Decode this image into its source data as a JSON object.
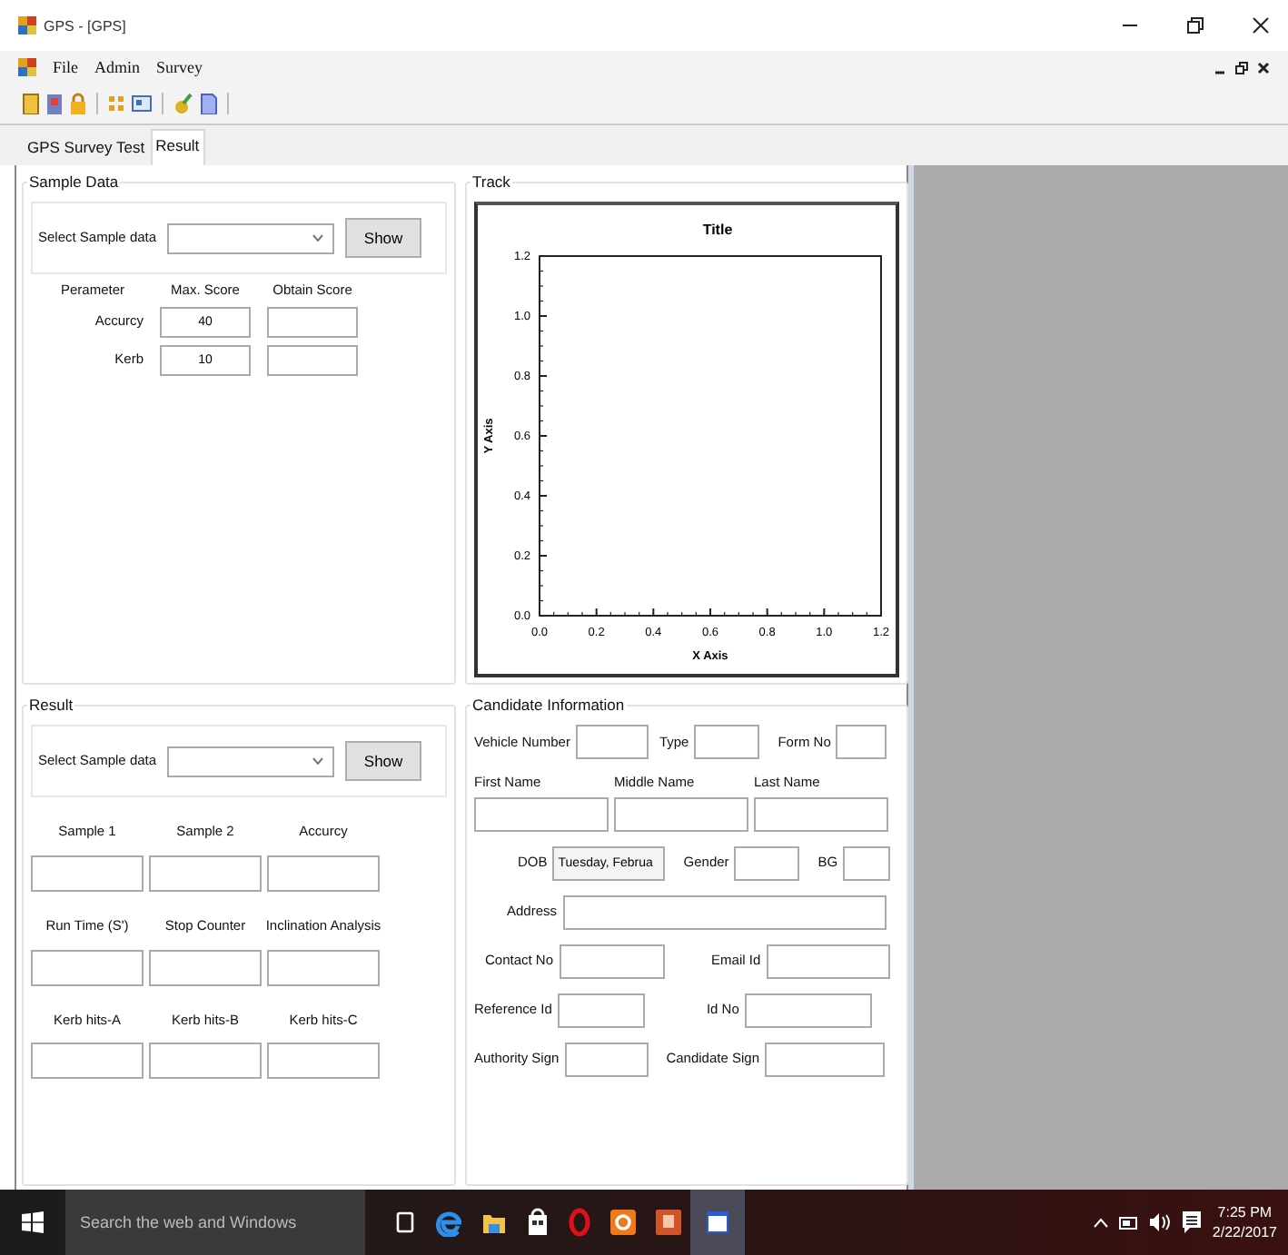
{
  "window": {
    "title": "GPS - [GPS]"
  },
  "menu": [
    "File",
    "Admin",
    "Survey"
  ],
  "tabs": [
    {
      "label": "GPS Survey Test",
      "selected": false
    },
    {
      "label": "Result",
      "selected": true
    }
  ],
  "sample_data": {
    "title": "Sample Data",
    "select_label": "Select Sample data",
    "show_button": "Show",
    "headers": [
      "Perameter",
      "Max. Score",
      "Obtain Score"
    ],
    "rows": [
      {
        "parameter": "Accurcy",
        "max_score": "40"
      },
      {
        "parameter": "Kerb",
        "max_score": "10"
      }
    ]
  },
  "track": {
    "title": "Track",
    "chart_data": {
      "type": "line",
      "title": "Title",
      "xlabel": "X Axis",
      "ylabel": "Y Axis",
      "xlim": [
        0,
        1.2
      ],
      "ylim": [
        0,
        1.2
      ],
      "xticks": [
        {
          "value": 0,
          "label": "0.0"
        },
        {
          "value": 0.2,
          "label": "0.2"
        },
        {
          "value": 0.4,
          "label": "0.4"
        },
        {
          "value": 0.6,
          "label": "0.6"
        },
        {
          "value": 0.8,
          "label": "0.8"
        },
        {
          "value": 1,
          "label": "1.0"
        },
        {
          "value": 1.2,
          "label": "1.2"
        }
      ],
      "yticks": [
        {
          "value": 0,
          "label": "0.0"
        },
        {
          "value": 0.2,
          "label": "0.2"
        },
        {
          "value": 0.4,
          "label": "0.4"
        },
        {
          "value": 0.6,
          "label": "0.6"
        },
        {
          "value": 0.8,
          "label": "0.8"
        },
        {
          "value": 1,
          "label": "1.0"
        },
        {
          "value": 1.2,
          "label": "1.2"
        }
      ]
    }
  },
  "result": {
    "title": "Result",
    "select_label": "Select Sample data",
    "show_button": "Show",
    "fields": [
      {
        "label": "Sample 1"
      },
      {
        "label": "Sample 2"
      },
      {
        "label": "Accurcy"
      },
      {
        "label": "Run Time (S')"
      },
      {
        "label": "Stop Counter"
      },
      {
        "label": "Inclination Analysis"
      },
      {
        "label": "Kerb hits-A"
      },
      {
        "label": "Kerb hits-B"
      },
      {
        "label": "Kerb hits-C"
      }
    ]
  },
  "candidate": {
    "title": "Candidate Information",
    "rows": [
      {
        "kind": "inline",
        "fields": [
          {
            "label": "Vehicle Number"
          },
          {
            "label": "Type"
          },
          {
            "label": "Form No"
          }
        ]
      },
      {
        "kind": "stacked",
        "fields": [
          {
            "label": "First Name"
          },
          {
            "label": "Middle Name"
          },
          {
            "label": "Last Name"
          }
        ]
      },
      {
        "kind": "inline",
        "fields": [
          {
            "label": "DOB",
            "value": "Tuesday, Februa"
          },
          {
            "label": "Gender"
          },
          {
            "label": "BG"
          }
        ]
      },
      {
        "kind": "inline",
        "fields": [
          {
            "label": "Address"
          }
        ]
      },
      {
        "kind": "inline",
        "fields": [
          {
            "label": "Contact No"
          },
          {
            "label": "Email Id"
          }
        ]
      },
      {
        "kind": "inline",
        "fields": [
          {
            "label": "Reference Id"
          },
          {
            "label": "Id No"
          }
        ]
      },
      {
        "kind": "inline",
        "fields": [
          {
            "label": "Authority Sign"
          },
          {
            "label": "Candidate Sign"
          }
        ]
      }
    ]
  },
  "taskbar": {
    "search_placeholder": "Search the web and Windows",
    "time": "7:25 PM",
    "date": "2/22/2017"
  }
}
